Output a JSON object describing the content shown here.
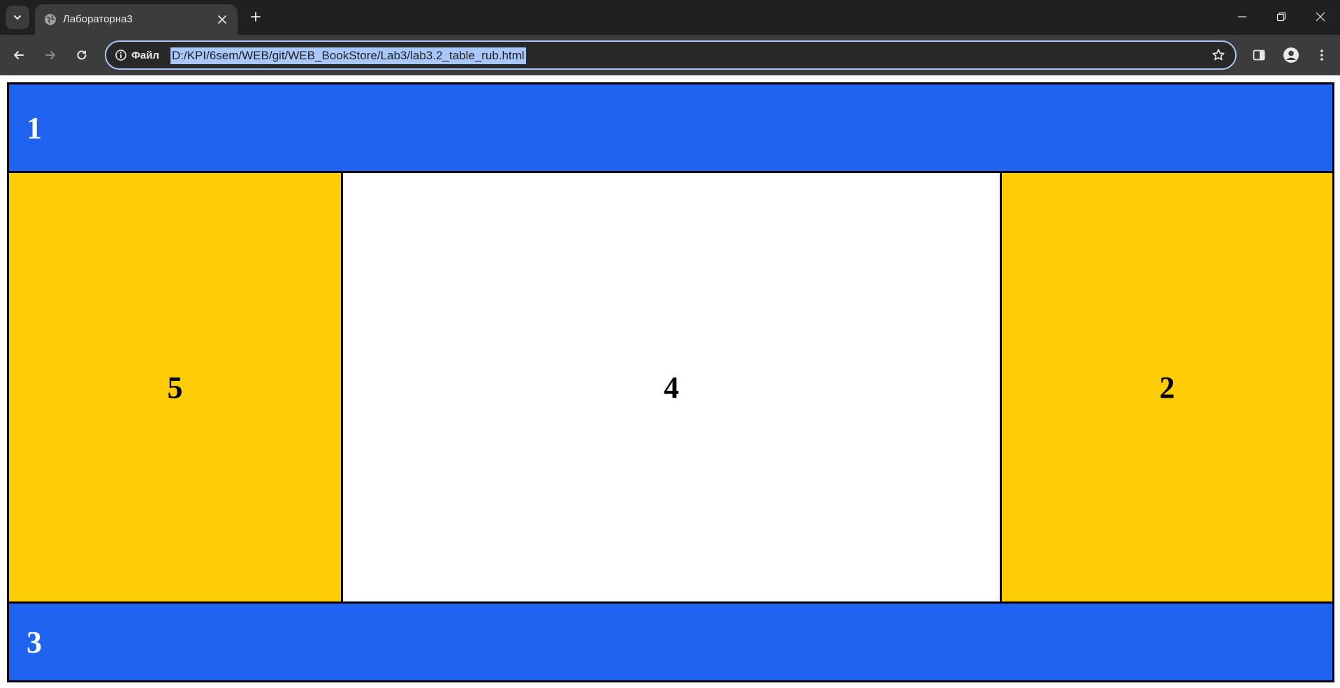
{
  "browser": {
    "tab": {
      "title": "Лабораторна3"
    },
    "address_bar": {
      "site_info_label": "Файл",
      "url": "D:/KPI/6sem/WEB/git/WEB_BookStore/Lab3/lab3.2_table_rub.html"
    },
    "colors": {
      "tabstrip": "#1f2020",
      "toolbar": "#3c3c3c",
      "url_highlight": "#a8c7fa"
    }
  },
  "page": {
    "colors": {
      "blue": "#1f63f0",
      "yellow": "#ffcc06",
      "white": "#ffffff",
      "border": "#000000"
    },
    "cells": {
      "header": "1",
      "left": "5",
      "center": "4",
      "right": "2",
      "footer": "3"
    }
  }
}
